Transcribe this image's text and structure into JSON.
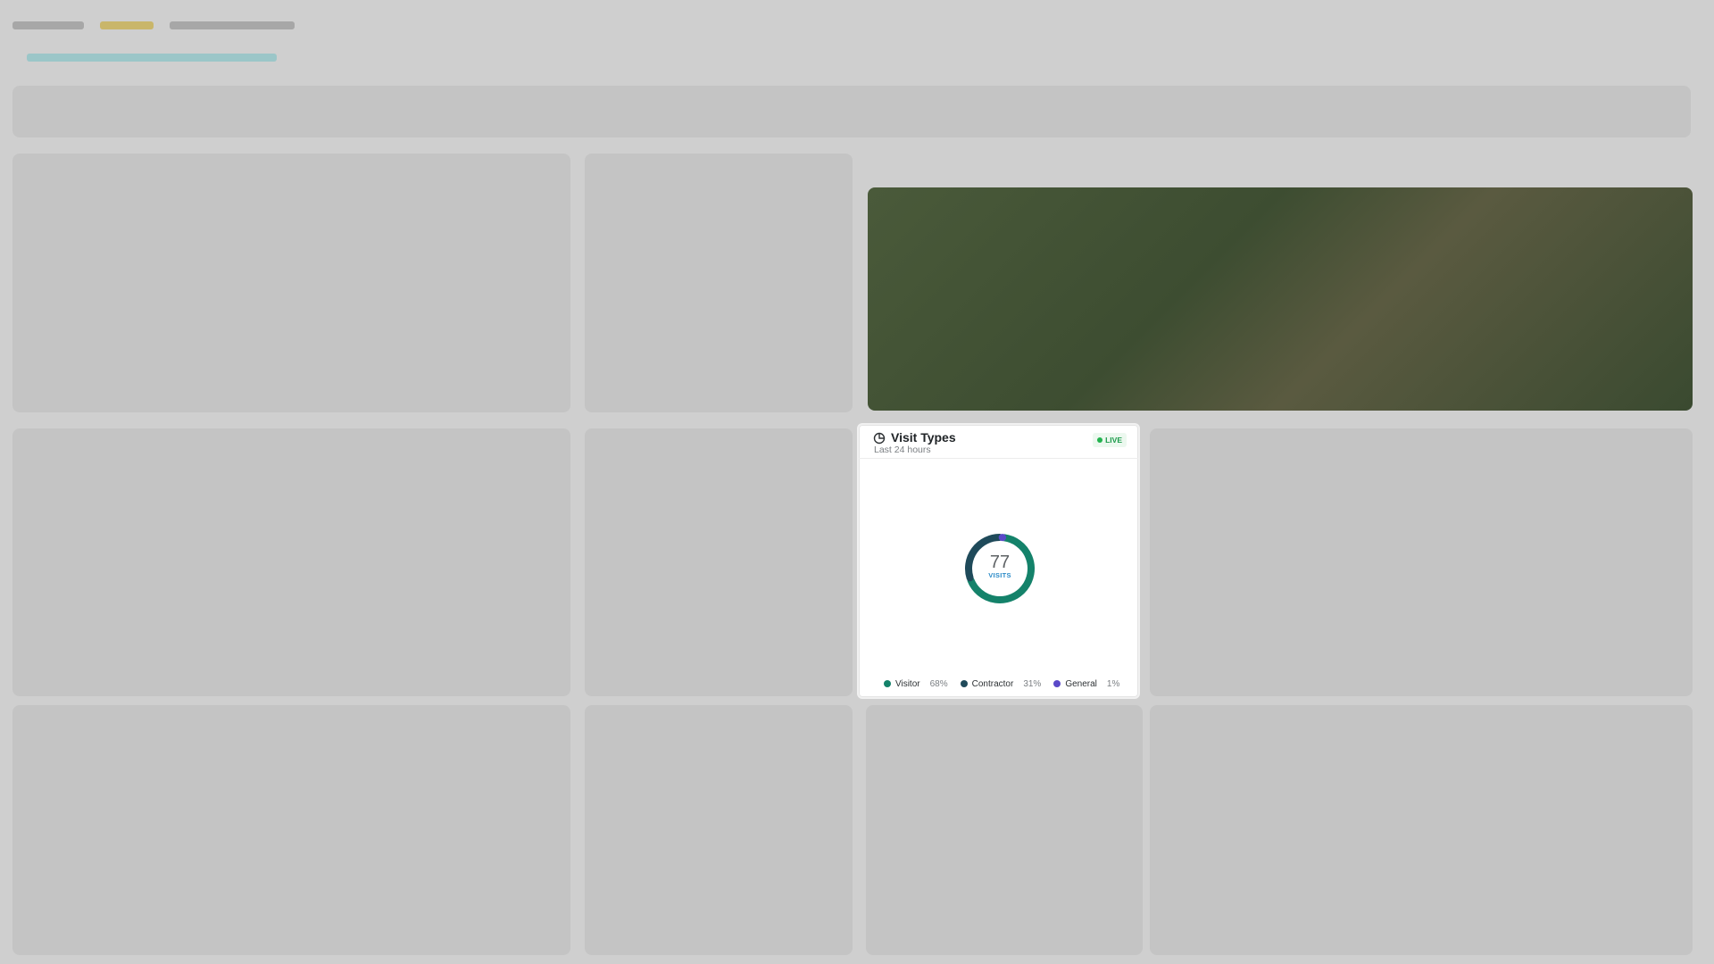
{
  "card": {
    "title": "Visit Types",
    "subtitle": "Last 24 hours",
    "live_label": "LIVE"
  },
  "colors": {
    "visitor": "#14826a",
    "contractor": "#1f4a5a",
    "general": "#5a49c8",
    "live": "#22b34e"
  },
  "chart_data": {
    "type": "pie",
    "total": "77",
    "total_label": "VISITS",
    "series": [
      {
        "name": "Visitor",
        "pct": "68%",
        "value": 68
      },
      {
        "name": "Contractor",
        "pct": "31%",
        "value": 31
      },
      {
        "name": "General",
        "pct": "1%",
        "value": 1
      }
    ]
  }
}
